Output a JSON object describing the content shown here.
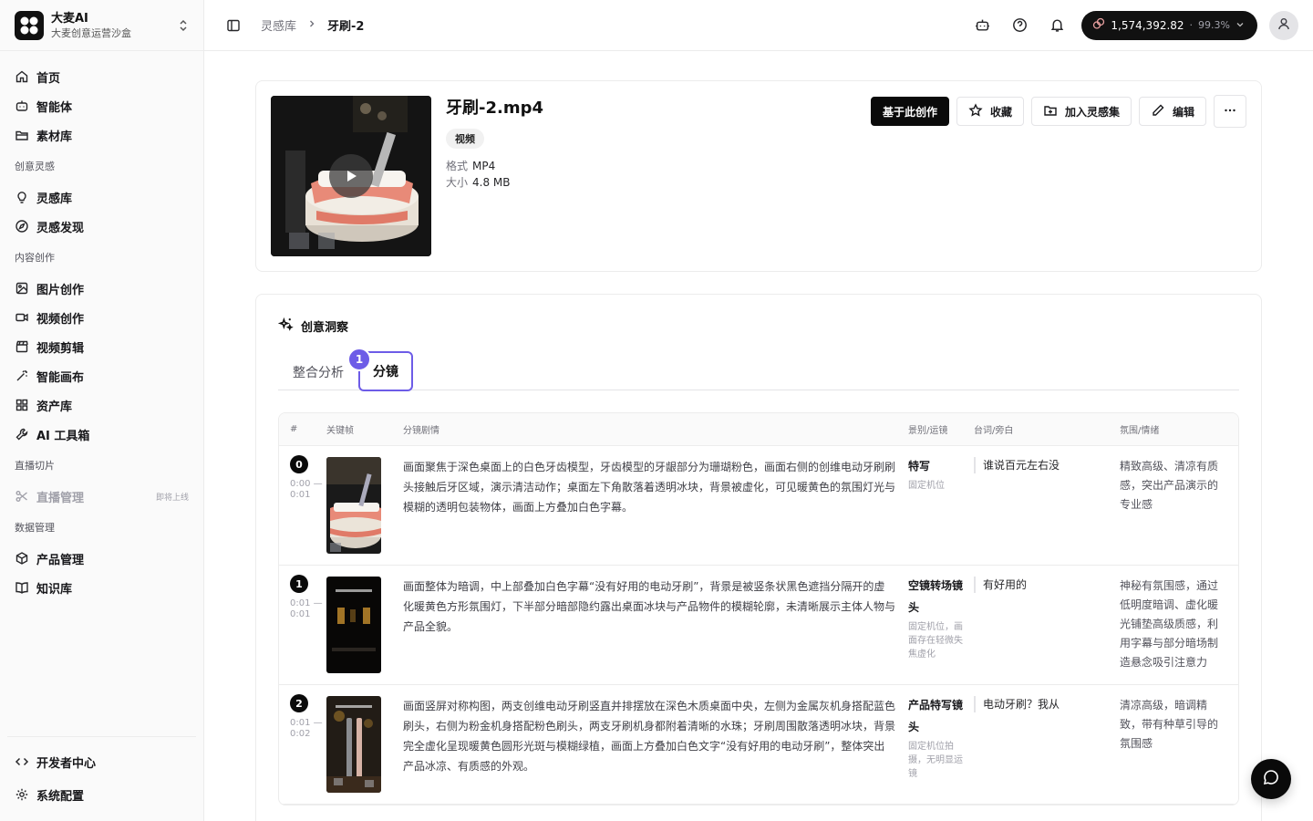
{
  "brand": {
    "name": "大麦AI",
    "subtitle": "大麦创意运营沙盒"
  },
  "nav": {
    "home": "首页",
    "agent": "智能体",
    "materials": "素材库",
    "group_creative": "创意灵感",
    "inspiration_lib": "灵感库",
    "inspiration_discover": "灵感发现",
    "group_content": "内容创作",
    "image_create": "图片创作",
    "video_create": "视频创作",
    "video_edit": "视频剪辑",
    "smart_canvas": "智能画布",
    "asset_lib": "资产库",
    "ai_toolbox": "AI 工具箱",
    "group_live": "直播切片",
    "live_manage": "直播管理",
    "live_tag": "即将上线",
    "group_data": "数据管理",
    "product_manage": "产品管理",
    "knowledge_base": "知识库",
    "dev_center": "开发者中心",
    "system_config": "系统配置"
  },
  "breadcrumb": {
    "parent": "灵感库",
    "current": "牙刷-2"
  },
  "credits": {
    "amount": "1,574,392.82",
    "percent": "99.3%"
  },
  "asset": {
    "title": "牙刷-2.mp4",
    "type_badge": "视频",
    "format_label": "格式",
    "format_value": "MP4",
    "size_label": "大小",
    "size_value": "4.8 MB",
    "actions": {
      "create": "基于此创作",
      "favorite": "收藏",
      "add_collection": "加入灵感集",
      "edit": "编辑"
    }
  },
  "insight": {
    "title": "创意洞察",
    "tabs": [
      "整合分析",
      "分镜"
    ],
    "step_number": "1",
    "columns": {
      "idx": "#",
      "frame": "关键帧",
      "desc": "分镜剧情",
      "shot": "景别/运镜",
      "line": "台词/旁白",
      "mood": "氛围/情绪"
    },
    "rows": [
      {
        "idx": "0",
        "time": "0:00 —0:01",
        "desc": "画面聚焦于深色桌面上的白色牙齿模型，牙齿模型的牙龈部分为珊瑚粉色，画面右侧的创维电动牙刷刷头接触后牙区域，演示清洁动作；桌面左下角散落着透明冰块，背景被虚化，可见暖黄色的氛围灯光与模糊的透明包装物体，画面上方叠加白色字幕。",
        "shot": "特写",
        "cam": "固定机位",
        "line": "谁说百元左右没",
        "mood": "精致高级、清凉有质感，突出产品演示的专业感"
      },
      {
        "idx": "1",
        "time": "0:01 —0:01",
        "desc": "画面整体为暗调，中上部叠加白色字幕“没有好用的电动牙刷”，背景是被竖条状黑色遮挡分隔开的虚化暖黄色方形氛围灯，下半部分暗部隐约露出桌面冰块与产品物件的模糊轮廓，未清晰展示主体人物与产品全貌。",
        "shot": "空镜转场镜头",
        "cam": "固定机位，画面存在轻微失焦虚化",
        "line": "有好用的",
        "mood": "神秘有氛围感，通过低明度暗调、虚化暖光铺垫高级质感，利用字幕与部分暗场制造悬念吸引注意力"
      },
      {
        "idx": "2",
        "time": "0:01 — 0:02",
        "desc": "画面竖屏对称构图，两支创维电动牙刷竖直并排摆放在深色木质桌面中央，左侧为金属灰机身搭配蓝色刷头，右侧为粉金机身搭配粉色刷头，两支牙刷机身都附着清晰的水珠；牙刷周围散落透明冰块，背景完全虚化呈现暖黄色圆形光斑与模糊绿植，画面上方叠加白色文字“没有好用的电动牙刷”，整体突出产品冰凉、有质感的外观。",
        "shot": "产品特写镜头",
        "cam": "固定机位拍摄，无明显运镜",
        "line": "电动牙刷？我从",
        "mood": "清凉高级，暗调精致，带有种草引导的氛围感"
      }
    ]
  },
  "colors": {
    "accent": "#6d5ce7",
    "primary": "#0a0a0a"
  }
}
